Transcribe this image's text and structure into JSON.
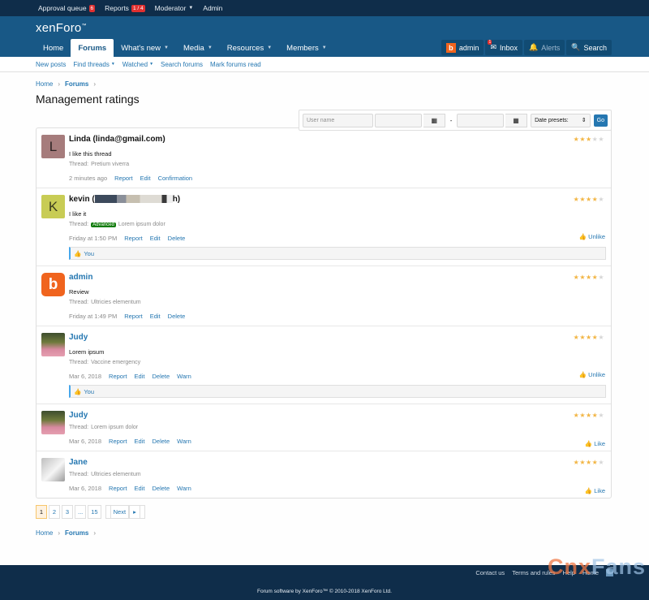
{
  "staffbar": {
    "approval_label": "Approval queue",
    "approval_count": "6",
    "reports_label": "Reports",
    "reports_count": "1 / 4",
    "moderator_label": "Moderator",
    "admin_label": "Admin"
  },
  "header": {
    "logo": "xenForo",
    "tabs": [
      "Home",
      "Forums",
      "What's new",
      "Media",
      "Resources",
      "Members"
    ],
    "user_label": "admin",
    "inbox_label": "Inbox",
    "inbox_count": "1",
    "alerts_label": "Alerts",
    "search_label": "Search"
  },
  "subnav": [
    "New posts",
    "Find threads",
    "Watched",
    "Search forums",
    "Mark forums read"
  ],
  "breadcrumb": {
    "home": "Home",
    "forums": "Forums"
  },
  "page_title": "Management ratings",
  "filters": {
    "username_placeholder": "User name",
    "dash": "-",
    "presets_label": "Date presets:",
    "go_label": "Go"
  },
  "ratings": [
    {
      "name": "Linda (linda@gmail.com)",
      "text": "I like this thread",
      "thread_prefix": "Thread:",
      "thread": "Pretium viverra",
      "time": "2 minutes ago",
      "actions": [
        "Report",
        "Edit",
        "Confirmation"
      ],
      "rating": 3
    },
    {
      "name_start": "kevin (",
      "name_end": "h)",
      "text": "I like it",
      "thread_prefix": "Thread:",
      "label": "Advanced",
      "thread": "Lorem ipsum dolor",
      "time": "Friday at 1:50 PM",
      "actions": [
        "Report",
        "Edit",
        "Delete"
      ],
      "rating": 4,
      "like_label": "Unlike",
      "likes_text": "You"
    },
    {
      "name": "admin",
      "text": "Review",
      "thread_prefix": "Thread:",
      "thread": "Ultricies elementum",
      "time": "Friday at 1:49 PM",
      "actions": [
        "Report",
        "Edit",
        "Delete"
      ],
      "rating": 4
    },
    {
      "name": "Judy",
      "text": "Lorem ipsum",
      "thread_prefix": "Thread:",
      "thread": "Vaccine emergency",
      "time": "Mar 6, 2018",
      "actions": [
        "Report",
        "Edit",
        "Delete",
        "Warn"
      ],
      "rating": 4,
      "like_label": "Unlike",
      "likes_text": "You"
    },
    {
      "name": "Judy",
      "thread_prefix": "Thread:",
      "thread": "Lorem ipsum dolor",
      "time": "Mar 6, 2018",
      "actions": [
        "Report",
        "Edit",
        "Delete",
        "Warn"
      ],
      "rating": 4,
      "like_label": "Like"
    },
    {
      "name": "Jane",
      "thread_prefix": "Thread:",
      "thread": "Ultricies elementum",
      "time": "Mar 6, 2018",
      "actions": [
        "Report",
        "Edit",
        "Delete",
        "Warn"
      ],
      "rating": 4,
      "like_label": "Like"
    }
  ],
  "avatars": {
    "linda": "L",
    "kevin": "K",
    "admin": "b"
  },
  "pagination": {
    "pages": [
      "1",
      "2",
      "3",
      "...",
      "15"
    ],
    "next": "Next"
  },
  "footer": {
    "links": [
      "Contact us",
      "Terms and rules",
      "Help",
      "Home"
    ],
    "copyright": "Forum software by XenForo™ © 2010-2018 XenForo Ltd."
  },
  "watermark": {
    "part1": "Cnx",
    "part2": "Fans"
  },
  "colors": {
    "accent": "#185886",
    "link": "#2577b1",
    "star": "#f2b544",
    "staffbar": "#0f2d4a"
  }
}
